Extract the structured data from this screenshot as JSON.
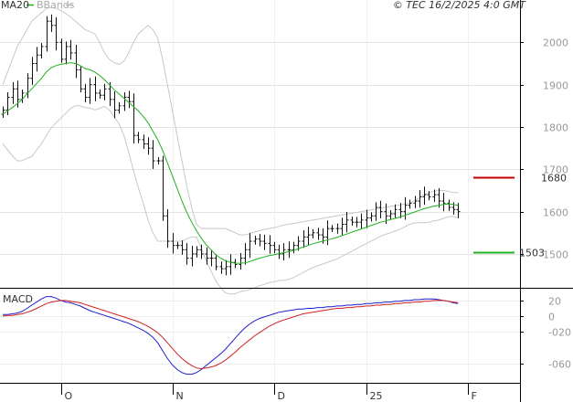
{
  "chart_data": [
    {
      "type": "ohlc",
      "panel": "price",
      "legend": [
        {
          "name": "MA20",
          "color": "#20b020"
        },
        {
          "name": "BBands",
          "color": "#bdbdbd"
        }
      ],
      "copyright": "© TEC 16/2/2025 4:0 GMT",
      "ylim": [
        1420,
        2100
      ],
      "yticks": [
        1500,
        1600,
        1700,
        1800,
        1900,
        2000
      ],
      "ytick_labels": [
        "1500",
        "1600",
        "1700",
        "1800",
        "1900",
        "2000"
      ],
      "grid": true,
      "resistance": {
        "value": 1680,
        "label": "1680",
        "color": "#c00000"
      },
      "support": {
        "value": 1503,
        "label": "1503",
        "color": "#20b020"
      },
      "x_labels": [
        {
          "label": "O",
          "index": 12
        },
        {
          "label": "N",
          "index": 35
        },
        {
          "label": "D",
          "index": 56
        },
        {
          "label": "25",
          "index": 75
        },
        {
          "label": "F",
          "index": 96
        }
      ],
      "series": {
        "close": [
          1840,
          1870,
          1890,
          1865,
          1880,
          1915,
          1950,
          1970,
          1990,
          2050,
          2040,
          2000,
          1960,
          1990,
          1975,
          1935,
          1890,
          1870,
          1900,
          1880,
          1875,
          1890,
          1865,
          1840,
          1850,
          1870,
          1860,
          1780,
          1770,
          1760,
          1750,
          1720,
          1720,
          1590,
          1530,
          1520,
          1520,
          1510,
          1490,
          1500,
          1510,
          1500,
          1490,
          1490,
          1470,
          1465,
          1470,
          1480,
          1475,
          1490,
          1510,
          1530,
          1535,
          1530,
          1525,
          1520,
          1510,
          1500,
          1510,
          1510,
          1520,
          1530,
          1540,
          1545,
          1550,
          1545,
          1540,
          1560,
          1560,
          1560,
          1570,
          1580,
          1575,
          1575,
          1580,
          1585,
          1590,
          1610,
          1600,
          1590,
          1595,
          1605,
          1600,
          1615,
          1620,
          1625,
          1635,
          1640,
          1635,
          1640,
          1625,
          1620,
          1610,
          1605,
          1600
        ],
        "ma20": [
          1830,
          1838,
          1846,
          1855,
          1865,
          1878,
          1890,
          1903,
          1915,
          1930,
          1940,
          1945,
          1948,
          1950,
          1952,
          1950,
          1945,
          1938,
          1935,
          1930,
          1922,
          1912,
          1900,
          1888,
          1878,
          1868,
          1858,
          1848,
          1838,
          1825,
          1810,
          1790,
          1770,
          1745,
          1715,
          1685,
          1655,
          1625,
          1598,
          1575,
          1555,
          1537,
          1522,
          1510,
          1498,
          1490,
          1484,
          1480,
          1478,
          1478,
          1479,
          1482,
          1486,
          1490,
          1493,
          1496,
          1498,
          1501,
          1503,
          1505,
          1508,
          1512,
          1516,
          1520,
          1524,
          1527,
          1530,
          1533,
          1536,
          1539,
          1543,
          1547,
          1551,
          1555,
          1559,
          1563,
          1567,
          1571,
          1575,
          1578,
          1581,
          1584,
          1587,
          1591,
          1595,
          1599,
          1603,
          1607,
          1610,
          1613,
          1615,
          1617,
          1618,
          1617,
          1615
        ],
        "bb_upper": [
          1900,
          1930,
          1960,
          1990,
          2010,
          2030,
          2050,
          2060,
          2070,
          2080,
          2082,
          2080,
          2075,
          2068,
          2060,
          2050,
          2040,
          2030,
          2025,
          2020,
          2000,
          1975,
          1960,
          1952,
          1948,
          1955,
          1975,
          2000,
          2020,
          2030,
          2040,
          2030,
          2010,
          1960,
          1900,
          1840,
          1780,
          1720,
          1660,
          1610,
          1570,
          1560,
          1560,
          1560,
          1560,
          1560,
          1560,
          1555,
          1550,
          1545,
          1545,
          1548,
          1552,
          1555,
          1558,
          1560,
          1562,
          1565,
          1568,
          1570,
          1572,
          1574,
          1576,
          1578,
          1580,
          1582,
          1584,
          1586,
          1588,
          1590,
          1592,
          1594,
          1596,
          1598,
          1600,
          1602,
          1604,
          1606,
          1608,
          1610,
          1612,
          1614,
          1616,
          1618,
          1620,
          1625,
          1632,
          1640,
          1645,
          1648,
          1650,
          1650,
          1648,
          1645,
          1645
        ],
        "bb_lower": [
          1760,
          1746,
          1732,
          1720,
          1720,
          1726,
          1730,
          1746,
          1760,
          1780,
          1798,
          1810,
          1821,
          1832,
          1844,
          1850,
          1850,
          1846,
          1845,
          1840,
          1844,
          1849,
          1840,
          1824,
          1808,
          1781,
          1741,
          1696,
          1656,
          1620,
          1580,
          1550,
          1530,
          1530,
          1530,
          1530,
          1530,
          1530,
          1536,
          1540,
          1540,
          1514,
          1484,
          1460,
          1436,
          1420,
          1408,
          1405,
          1406,
          1411,
          1413,
          1416,
          1420,
          1425,
          1428,
          1432,
          1434,
          1437,
          1438,
          1440,
          1444,
          1450,
          1456,
          1462,
          1468,
          1472,
          1476,
          1480,
          1484,
          1488,
          1494,
          1500,
          1506,
          1512,
          1518,
          1524,
          1530,
          1536,
          1542,
          1546,
          1550,
          1554,
          1558,
          1564,
          1570,
          1573,
          1574,
          1574,
          1575,
          1578,
          1580,
          1584,
          1588,
          1589,
          1585
        ]
      }
    },
    {
      "type": "line",
      "panel": "macd",
      "title": "MACD",
      "ylim": [
        -85,
        35
      ],
      "yticks": [
        20,
        0,
        -20,
        -60
      ],
      "ytick_labels": [
        "20",
        "0",
        "-020",
        "-060"
      ],
      "series": [
        {
          "color": "#1e1ed0",
          "values": [
            2,
            2,
            3,
            4,
            6,
            10,
            14,
            18,
            22,
            25,
            25,
            23,
            20,
            18,
            17,
            15,
            13,
            10,
            7,
            5,
            3,
            1,
            -1,
            -3,
            -5,
            -7,
            -9,
            -12,
            -15,
            -18,
            -22,
            -27,
            -34,
            -44,
            -54,
            -62,
            -68,
            -72,
            -74,
            -74,
            -72,
            -68,
            -63,
            -58,
            -53,
            -48,
            -42,
            -35,
            -28,
            -21,
            -15,
            -10,
            -6,
            -3,
            -1,
            1,
            3,
            5,
            6,
            7,
            8,
            9,
            9,
            10,
            10,
            11,
            11,
            12,
            12,
            13,
            13,
            14,
            14,
            15,
            15,
            16,
            16,
            17,
            17,
            18,
            18,
            19,
            19,
            20,
            20,
            21,
            21,
            22,
            22,
            22,
            21,
            20,
            19,
            17,
            16
          ]
        },
        {
          "color": "#d02020",
          "values": [
            0,
            1,
            1,
            2,
            3,
            5,
            7,
            10,
            13,
            16,
            18,
            19,
            20,
            20,
            19,
            18,
            17,
            15,
            13,
            11,
            9,
            7,
            5,
            3,
            1,
            -1,
            -3,
            -5,
            -7,
            -10,
            -13,
            -17,
            -21,
            -27,
            -34,
            -41,
            -48,
            -54,
            -59,
            -63,
            -66,
            -67,
            -66,
            -65,
            -63,
            -60,
            -56,
            -51,
            -46,
            -40,
            -35,
            -30,
            -25,
            -21,
            -17,
            -13,
            -10,
            -7,
            -5,
            -3,
            -1,
            1,
            3,
            4,
            5,
            6,
            7,
            8,
            9,
            10,
            10,
            11,
            11,
            12,
            12,
            13,
            13,
            14,
            14,
            15,
            15,
            16,
            16,
            17,
            17,
            18,
            18,
            19,
            19,
            20,
            20,
            20,
            19,
            18,
            17
          ]
        }
      ]
    }
  ]
}
